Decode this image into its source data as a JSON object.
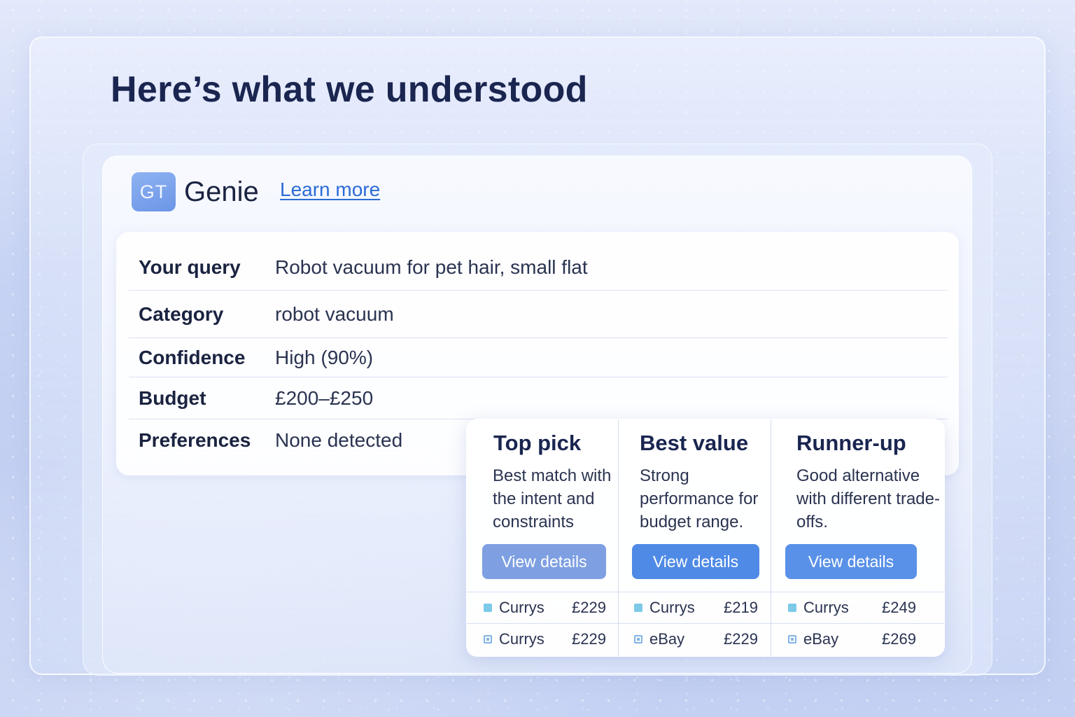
{
  "page": {
    "title": "Here’s what we understood"
  },
  "brand": {
    "logo_text": "GT",
    "name": "Genie",
    "learn_more": "Learn more"
  },
  "understanding": {
    "rows": [
      {
        "label": "Your query",
        "value": "Robot vacuum for pet hair, small flat"
      },
      {
        "label": "Category",
        "value": "robot vacuum"
      },
      {
        "label": "Confidence",
        "value": "High (90%)"
      },
      {
        "label": "Budget",
        "value": "£200–£250"
      },
      {
        "label": "Preferences",
        "value": "None detected"
      }
    ]
  },
  "picks": [
    {
      "title": "Top pick",
      "description": "Best match with the intent and constraints",
      "button": "View details",
      "offers": [
        {
          "store": "Currys",
          "price": "£229",
          "icon": "store-square-icon"
        },
        {
          "store": "Currys",
          "price": "£229",
          "icon": "store-box-icon"
        }
      ]
    },
    {
      "title": "Best value",
      "description": "Strong performance for budget range.",
      "button": "View details",
      "offers": [
        {
          "store": "Currys",
          "price": "£219",
          "icon": "store-square-icon"
        },
        {
          "store": "eBay",
          "price": "£229",
          "icon": "store-box-icon"
        }
      ]
    },
    {
      "title": "Runner-up",
      "description": "Good alternative with different trade-offs.",
      "button": "View details",
      "offers": [
        {
          "store": "Currys",
          "price": "£249",
          "icon": "store-square-icon"
        },
        {
          "store": "eBay",
          "price": "£269",
          "icon": "store-box-icon"
        }
      ]
    }
  ],
  "colors": {
    "accent": "#4f8ae6",
    "link": "#2b6bd6",
    "heading": "#1a2550"
  }
}
